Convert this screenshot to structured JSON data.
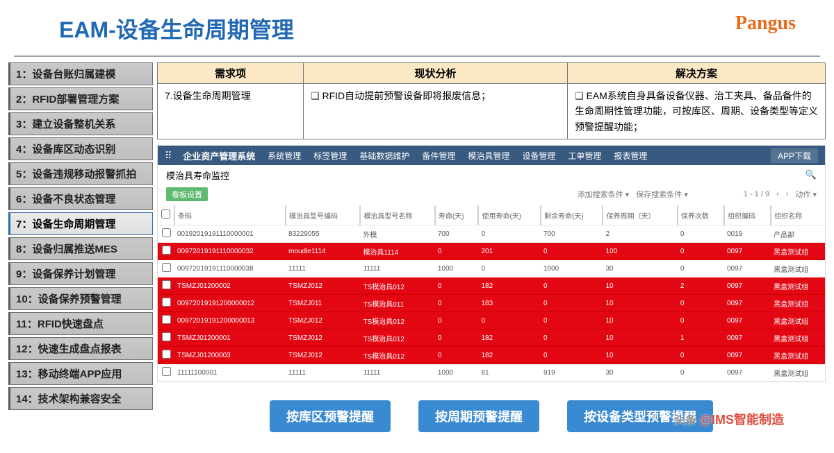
{
  "title": "EAM-设备生命周期管理",
  "logo": "Pangus",
  "sidebar": {
    "items": [
      {
        "label": "1：设备台账归属建模"
      },
      {
        "label": "2：RFID部署管理方案"
      },
      {
        "label": "3：建立设备整机关系"
      },
      {
        "label": "4：设备库区动态识别"
      },
      {
        "label": "5：设备违规移动报警抓拍"
      },
      {
        "label": "6：设备不良状态管理"
      },
      {
        "label": "7：设备生命周期管理"
      },
      {
        "label": "8：设备归属推送MES"
      },
      {
        "label": "9：设备保养计划管理"
      },
      {
        "label": "10：设备保养预警管理"
      },
      {
        "label": "11：RFID快速盘点"
      },
      {
        "label": "12：快速生成盘点报表"
      },
      {
        "label": "13：移动终端APP应用"
      },
      {
        "label": "14：技术架构兼容安全"
      }
    ],
    "active_index": 6
  },
  "info_table": {
    "headers": [
      "需求项",
      "现状分析",
      "解决方案"
    ],
    "req": "7.设备生命周期管理",
    "analysis": "RFID自动提前预警设备即将报废信息；",
    "solution": "EAM系统自身具备设备仪器、治工夹具、备品备件的生命周期性管理功能，可按库区、周期、设备类型等定义预警提醒功能；"
  },
  "app": {
    "brand": "企业资产管理系统",
    "nav": [
      "系统管理",
      "标签管理",
      "基础数据维护",
      "备件管理",
      "模治具管理",
      "设备管理",
      "工单管理",
      "报表管理"
    ],
    "download": "APP下载",
    "panel_title": "模治具寿命监控",
    "tag_btn": "看板设置",
    "filter_add": "添加搜索条件 ▾",
    "filter_save": "保存搜索条件 ▾",
    "pager": "1 - 1 / 9",
    "action": "动作 ▾",
    "columns": [
      "",
      "条码",
      "模治具型号编码",
      "模治具型号名称",
      "寿命(天)",
      "使用寿命(天)",
      "剩余寿命(天)",
      "保养周期（天）",
      "保养次数",
      "组织编码",
      "组织名称"
    ],
    "rows": [
      {
        "alert": false,
        "c": [
          "00192019191110000001",
          "83229055",
          "外模",
          "700",
          "0",
          "700",
          "2",
          "0",
          "0019",
          "产品部"
        ]
      },
      {
        "alert": true,
        "c": [
          "00972019191110000032",
          "moudle1114",
          "模治具1114",
          "0",
          "201",
          "0",
          "100",
          "0",
          "0097",
          "黑盒测试组"
        ]
      },
      {
        "alert": false,
        "c": [
          "00972019191110000038",
          "11111",
          "11111",
          "1000",
          "0",
          "1000",
          "30",
          "0",
          "0097",
          "黑盒测试组"
        ]
      },
      {
        "alert": true,
        "c": [
          "TSMZJ01200002",
          "TSMZJ012",
          "TS模治具012",
          "0",
          "182",
          "0",
          "10",
          "2",
          "0097",
          "黑盒测试组"
        ]
      },
      {
        "alert": true,
        "c": [
          "00972019191200000012",
          "TSMZJ011",
          "TS模治具011",
          "0",
          "183",
          "0",
          "10",
          "0",
          "0097",
          "黑盒测试组"
        ]
      },
      {
        "alert": true,
        "c": [
          "00972019191200000013",
          "TSMZJ012",
          "TS模治具012",
          "0",
          "0",
          "0",
          "10",
          "0",
          "0097",
          "黑盒测试组"
        ]
      },
      {
        "alert": true,
        "c": [
          "TSMZJ01200001",
          "TSMZJ012",
          "TS模治具012",
          "0",
          "182",
          "0",
          "10",
          "1",
          "0097",
          "黑盒测试组"
        ]
      },
      {
        "alert": true,
        "c": [
          "TSMZJ01200003",
          "TSMZJ012",
          "TS模治具012",
          "0",
          "182",
          "0",
          "10",
          "0",
          "0097",
          "黑盒测试组"
        ]
      },
      {
        "alert": false,
        "c": [
          "11111100001",
          "11111",
          "11111",
          "1000",
          "81",
          "919",
          "30",
          "0",
          "0097",
          "黑盒测试组"
        ]
      }
    ]
  },
  "buttons": [
    "按库区预警提醒",
    "按周期预警提醒",
    "按设备类型预警提醒"
  ],
  "watermark_pre": "头条 ",
  "watermark": "@IMS智能制造"
}
